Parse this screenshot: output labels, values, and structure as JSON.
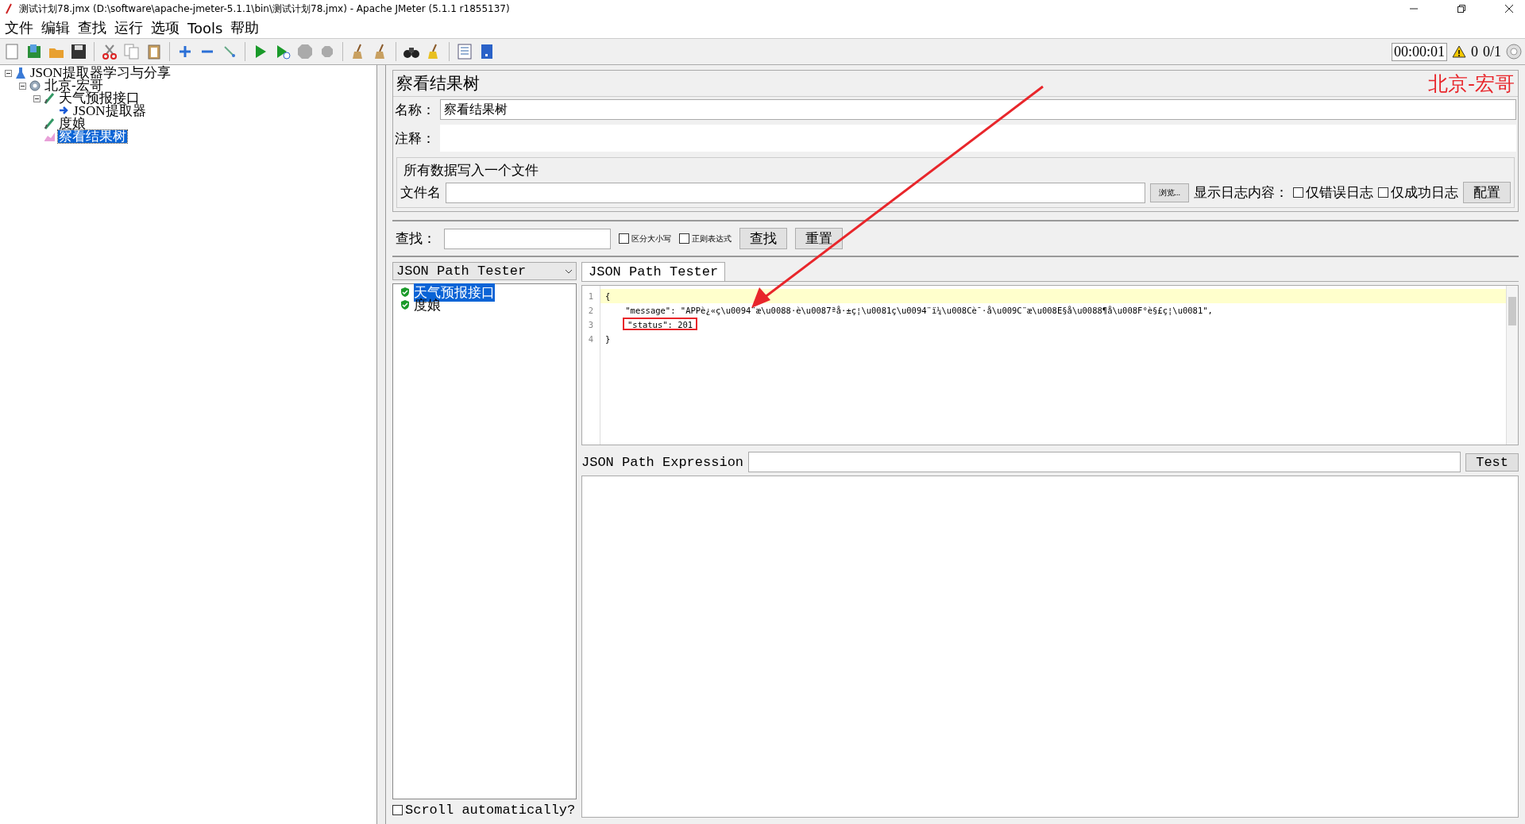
{
  "window": {
    "title": "测试计划78.jmx (D:\\software\\apache-jmeter-5.1.1\\bin\\测试计划78.jmx) - Apache JMeter (5.1.1 r1855137)"
  },
  "menu": [
    "文件",
    "编辑",
    "查找",
    "运行",
    "选项",
    "Tools",
    "帮助"
  ],
  "status": {
    "timer": "00:00:01",
    "warnings": "0",
    "threads": "0/1"
  },
  "tree": [
    {
      "label": "JSON提取器学习与分享",
      "kind": "plan",
      "selected": false,
      "expanded": true,
      "children": [
        {
          "label": "北京-宏哥",
          "kind": "thread-group",
          "selected": false,
          "expanded": true,
          "children": [
            {
              "label": "天气预报接口",
              "kind": "sampler",
              "selected": false,
              "expanded": true,
              "children": [
                {
                  "label": "JSON提取器",
                  "kind": "extractor",
                  "selected": false
                }
              ]
            },
            {
              "label": "度娘",
              "kind": "sampler",
              "selected": false
            },
            {
              "label": "察看结果树",
              "kind": "listener",
              "selected": true
            }
          ]
        }
      ]
    }
  ],
  "panel": {
    "title": "察看结果树",
    "annotation": "北京-宏哥",
    "name_label": "名称：",
    "name_value": "察看结果树",
    "comment_label": "注释：",
    "file_section": {
      "legend": "所有数据写入一个文件",
      "file_label": "文件名",
      "browse_button": "浏览...",
      "log_label": "显示日志内容：",
      "checkboxes": [
        {
          "label": "仅错误日志",
          "checked": false
        },
        {
          "label": "仅成功日志",
          "checked": false
        }
      ],
      "config_button": "配置"
    },
    "search": {
      "label": "查找：",
      "checkboxes": [
        {
          "label": "区分大小写",
          "checked": false
        },
        {
          "label": "正则表达式",
          "checked": false
        }
      ],
      "find_button": "查找",
      "reset_button": "重置"
    },
    "renderer": "JSON Path Tester",
    "results": [
      {
        "label": "天气预报接口",
        "selected": true
      },
      {
        "label": "度娘",
        "selected": false
      }
    ],
    "scroll_checkbox": {
      "label": "Scroll automatically?",
      "checked": false
    },
    "tabs": [
      {
        "label": "JSON Path Tester",
        "selected": true
      }
    ],
    "code": [
      {
        "number": "1",
        "text": "{",
        "current": true,
        "boxed": false
      },
      {
        "number": "2",
        "text": "    \"message\": \"APPè¿«ç\\u0094¨æ\\u0088·è\\u0087ªå·±ç¦\\u0081ç\\u0094¨ï¼\\u008Cè¯·å\\u009C¨æ\\u008E§å\\u0088¶å\\u008F°è§£ç¦\\u0081\",",
        "current": false,
        "boxed": false
      },
      {
        "number": "3",
        "text": "\"status\": 201",
        "current": false,
        "boxed": true
      },
      {
        "number": "4",
        "text": "}",
        "current": false,
        "boxed": false
      }
    ],
    "expression_label": "JSON Path Expression",
    "test_button": "Test"
  }
}
